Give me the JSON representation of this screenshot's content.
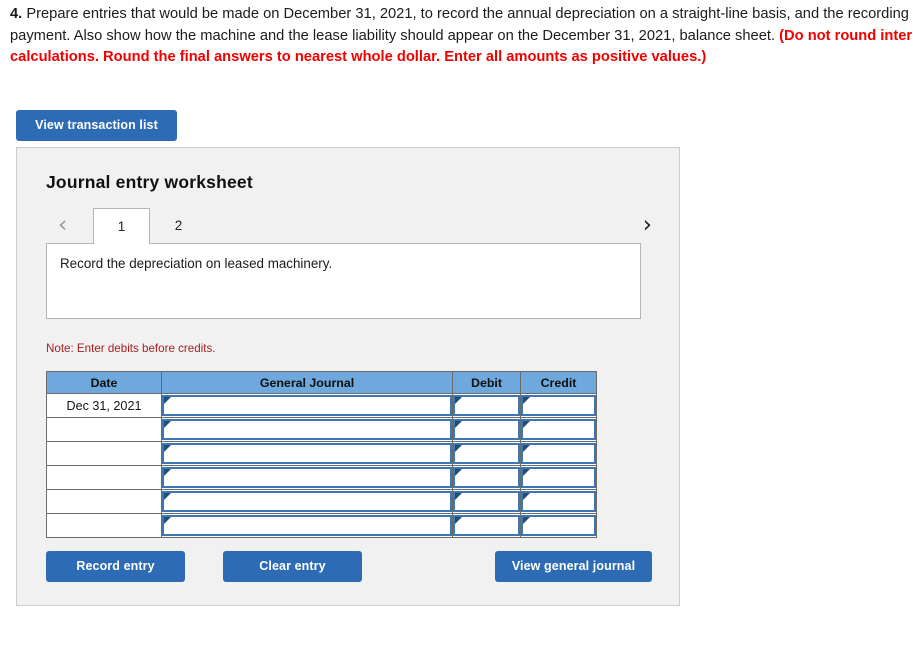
{
  "prompt": {
    "number": "4.",
    "body_part1": " Prepare entries that would be made on December 31, 2021, to record the annual depreciation on a straight-line basis, and the recording of the lease payment. Also show how the machine and the lease liability should appear on the December 31, 2021, balance sheet. ",
    "red_note": "(Do not round intermediate calculations. Round the final answers to nearest whole dollar. Enter all amounts as positive values.)"
  },
  "toolbar": {
    "view_transaction_list": "View transaction list"
  },
  "panel": {
    "title": "Journal entry worksheet",
    "tabs": [
      {
        "label": "1",
        "active": true
      },
      {
        "label": "2",
        "active": false
      }
    ],
    "nav": {
      "prev_icon": "chevron-left-icon",
      "next_icon": "chevron-right-icon",
      "prev_glyph": "‹",
      "next_glyph": "›"
    },
    "instruction": "Record the depreciation on leased machinery.",
    "note": "Note: Enter debits before credits."
  },
  "table": {
    "headers": [
      "Date",
      "General Journal",
      "Debit",
      "Credit"
    ],
    "rows": [
      {
        "date": "Dec 31, 2021",
        "general_journal": "",
        "debit": "",
        "credit": ""
      },
      {
        "date": "",
        "general_journal": "",
        "debit": "",
        "credit": ""
      },
      {
        "date": "",
        "general_journal": "",
        "debit": "",
        "credit": ""
      },
      {
        "date": "",
        "general_journal": "",
        "debit": "",
        "credit": ""
      },
      {
        "date": "",
        "general_journal": "",
        "debit": "",
        "credit": ""
      },
      {
        "date": "",
        "general_journal": "",
        "debit": "",
        "credit": ""
      }
    ]
  },
  "footer": {
    "record_entry": "Record entry",
    "clear_entry": "Clear entry",
    "view_general_journal": "View general journal"
  },
  "colors": {
    "button_blue": "#2d6cb4",
    "table_header_blue": "#6fa8dc",
    "input_border_blue": "#3d76b0",
    "marker_blue": "#1f4e79",
    "alert_red": "#f20000",
    "note_red": "#a82020",
    "panel_bg": "#f1f1f1"
  }
}
